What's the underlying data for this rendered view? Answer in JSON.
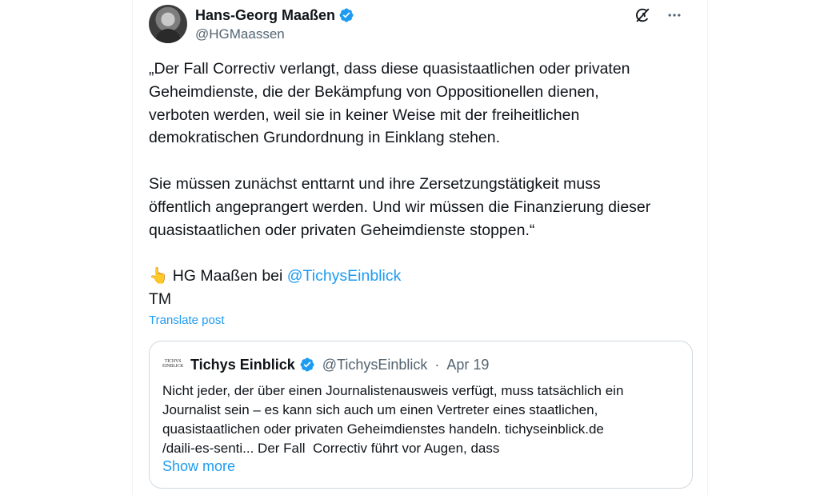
{
  "post": {
    "author_name": "Hans-Georg Maaßen",
    "author_handle": "@HGMaassen",
    "paragraph1": "„Der Fall Correctiv verlangt, dass diese quasistaatlichen oder privaten\nGeheimdienste, die der Bekämpfung von Oppositionellen dienen,\nverboten werden, weil sie in keiner Weise mit der freiheitlichen\ndemokratischen Grundordnung in Einklang stehen.",
    "paragraph2": "Sie müssen zunächst enttarnt und ihre Zersetzungstätigkeit muss\nöffentlich angeprangert werden. Und wir müssen die Finanzierung dieser\nquasistaatlichen oder privaten Geheimdienste stoppen.“",
    "attribution_emoji": "👆",
    "attribution_text": " HG Maaßen bei ",
    "attribution_mention": "@TichysEinblick",
    "signature": "TM",
    "translate_label": "Translate post"
  },
  "quote": {
    "logo_text": "TICHYS EINBLICK",
    "author_name": "Tichys Einblick",
    "author_handle": "@TichysEinblick",
    "separator": "·",
    "date": "Apr 19",
    "text": "Nicht jeder, der über einen Journalistenausweis verfügt, muss tatsächlich ein\nJournalist sein – es kann sich auch um einen Vertreter eines staatlichen,\nquasistaatlichen oder privaten Geheimdienstes handeln. tichyseinblick.de\n/daili-es-senti... Der Fall  Correctiv führt vor Augen, dass",
    "show_more_label": "Show more"
  },
  "icons": {
    "verified": "verified-badge-icon",
    "grok": "grok-icon",
    "more": "more-icon"
  },
  "colors": {
    "accent": "#1d9bf0",
    "text": "#0f1419",
    "secondary": "#536471",
    "border": "#cfd9de"
  }
}
